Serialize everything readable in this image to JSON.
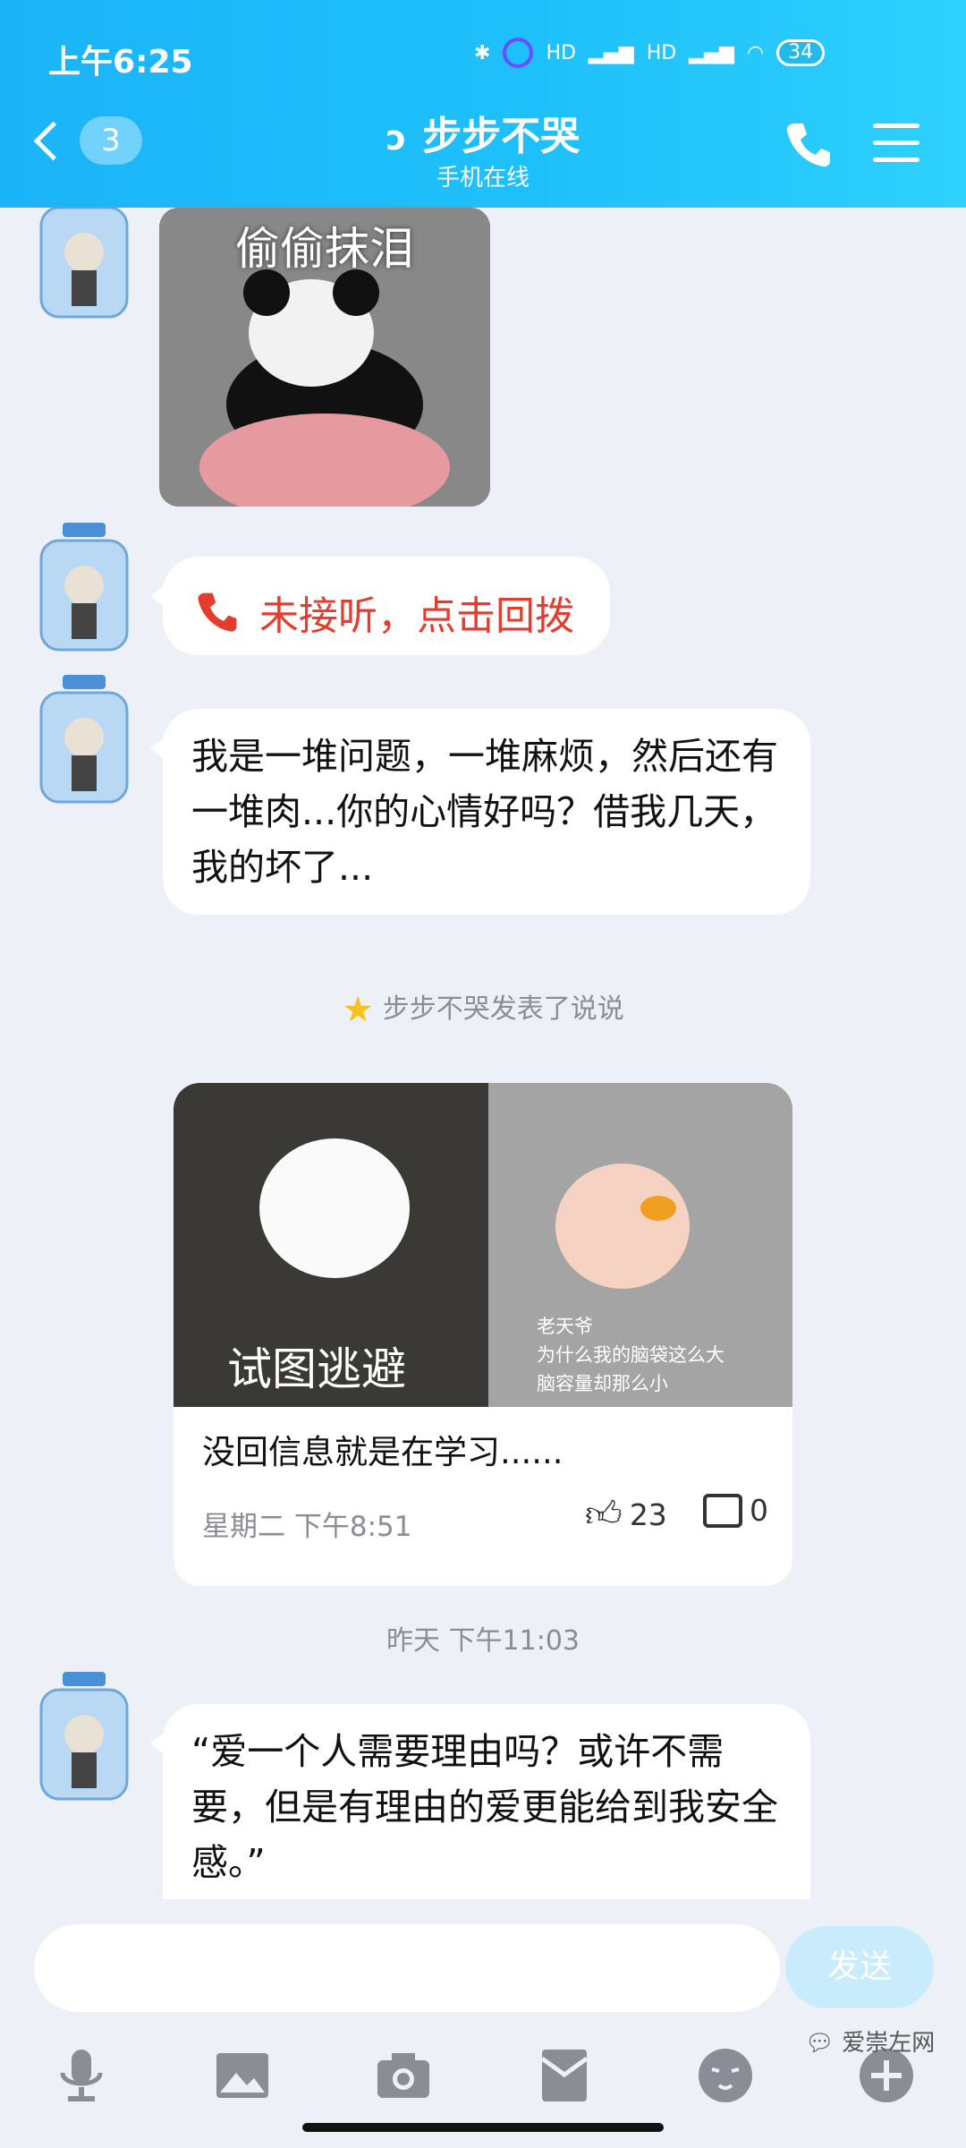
{
  "status_bar": {
    "time": "上午6:25",
    "signal1": "HD",
    "signal2": "HD",
    "battery": "34"
  },
  "header": {
    "back_count": "3",
    "title": "步步不哭",
    "subtitle": "手机在线"
  },
  "messages": {
    "sticker1_text": "偷偷抹泪",
    "missed_call": "未接听，点击回拨",
    "text1": "我是一堆问题，一堆麻烦，然后还有一堆肉...你的心情好吗？借我几天，我的坏了...",
    "system_post": "步步不哭发表了说说",
    "card": {
      "img_left_caption": "试图逃避",
      "img_right_caption": "老天爷\n为什么我的脑袋这么大\n脑容量却那么小",
      "text": "没回信息就是在学习......",
      "time": "星期二 下午8:51",
      "likes": "23",
      "comments": "0"
    },
    "timestamp": "昨天 下午11:03",
    "text2": "“爱一个人需要理由吗？或许不需要，但是有理由的爱更能给到我安全感。”"
  },
  "input": {
    "send_label": "发送",
    "placeholder": ""
  },
  "toolbar_icons": [
    "microphone-icon",
    "image-icon",
    "camera-icon",
    "red-packet-icon",
    "emoji-icon",
    "plus-icon"
  ],
  "watermark": "爱崇左网",
  "colors": {
    "header": "#1ec0fb",
    "missed_call": "#e53c2d",
    "send_disabled": "#c8ecfb"
  }
}
